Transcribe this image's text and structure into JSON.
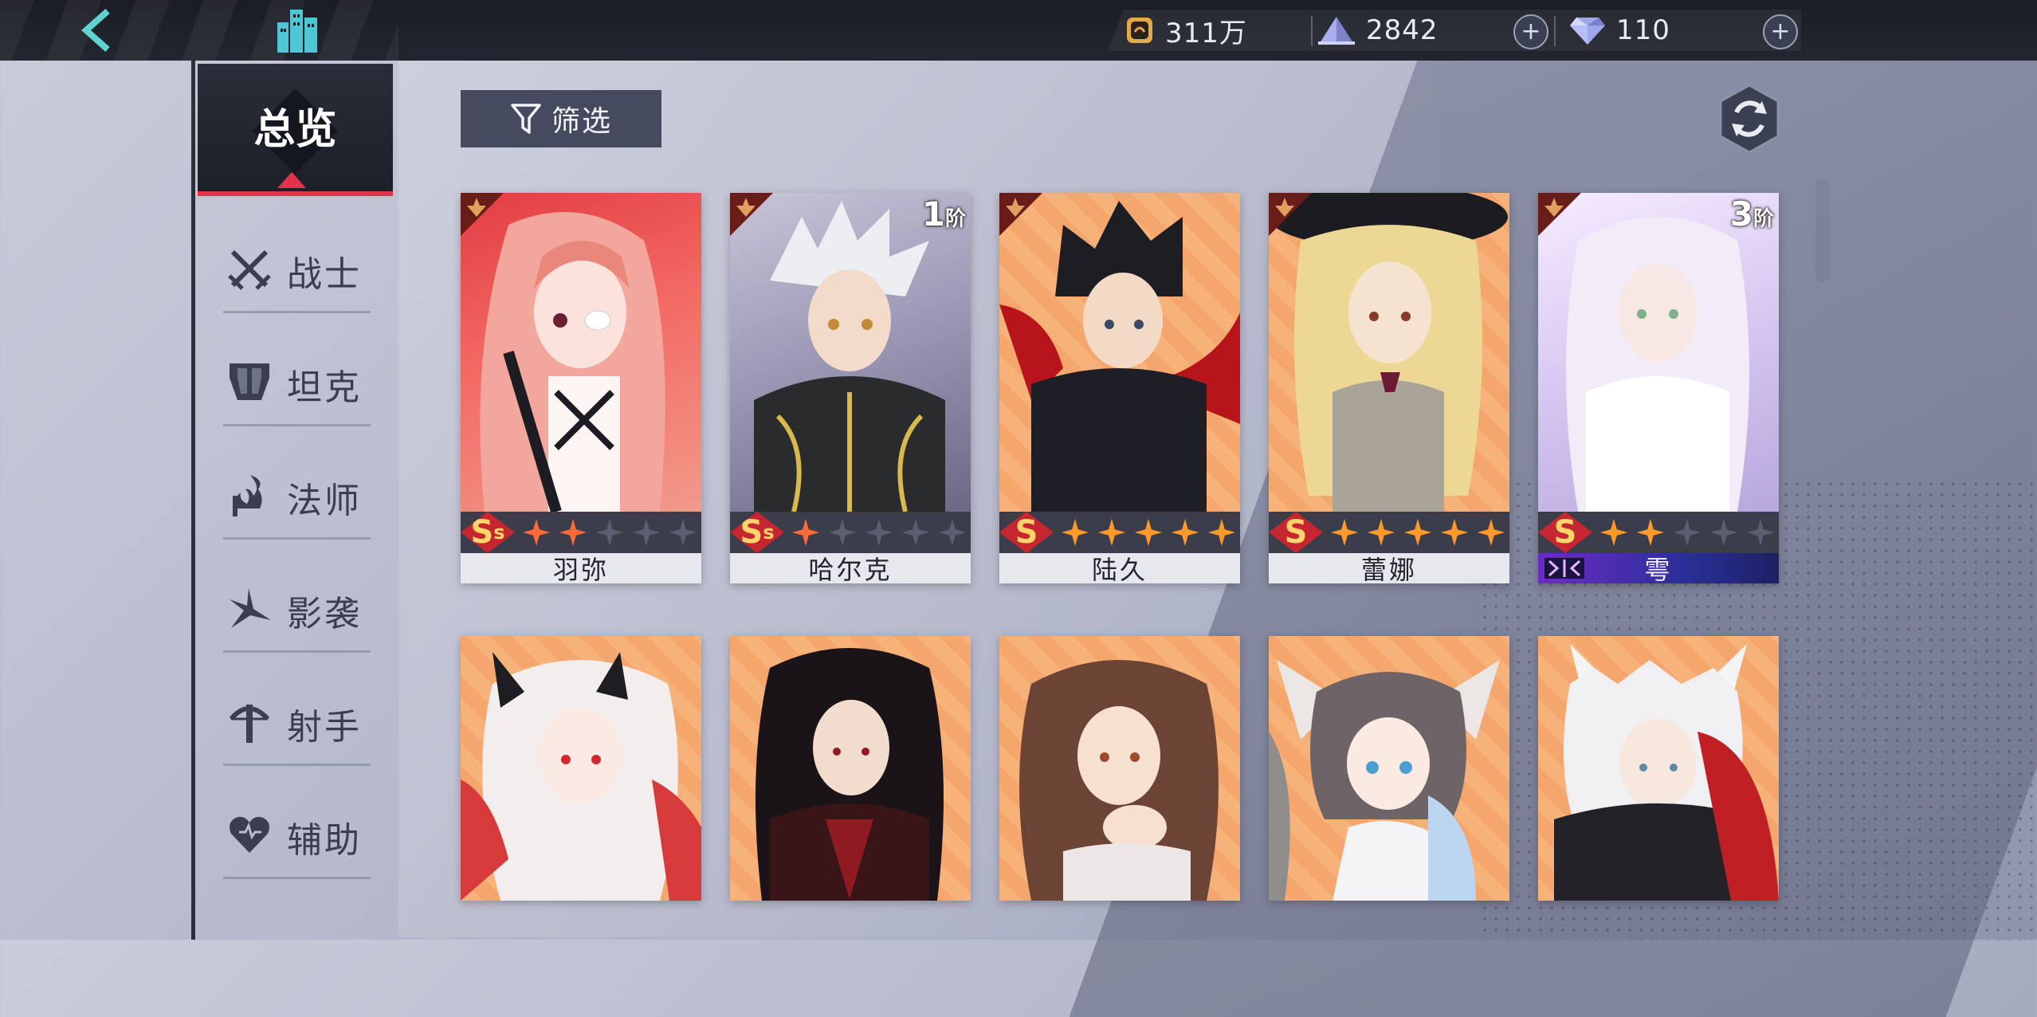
{
  "resources": {
    "gold": "311万",
    "crystal": "2842",
    "diamond": "110"
  },
  "sidebar": {
    "overview": "总览",
    "items": [
      {
        "label": "战士",
        "icon": "crossed-swords-icon"
      },
      {
        "label": "坦克",
        "icon": "tank-shield-icon"
      },
      {
        "label": "法师",
        "icon": "mage-staff-icon"
      },
      {
        "label": "影袭",
        "icon": "shadow-blade-icon"
      },
      {
        "label": "射手",
        "icon": "bow-icon"
      },
      {
        "label": "辅助",
        "icon": "heart-icon"
      }
    ]
  },
  "toolbar": {
    "filter_label": "筛选"
  },
  "heroes": [
    {
      "name": "羽弥",
      "grade": "S",
      "grade_sub": "s",
      "stars_lit": 2,
      "stars_total": 5,
      "rank": "",
      "accent": "#e23c43"
    },
    {
      "name": "哈尔克",
      "grade": "S",
      "grade_sub": "s",
      "stars_lit": 1,
      "stars_total": 5,
      "rank": "1",
      "rank_unit": "阶",
      "accent": "#8e8aa6"
    },
    {
      "name": "陆久",
      "grade": "S",
      "grade_sub": "",
      "stars_lit": 5,
      "stars_total": 5,
      "rank": "",
      "accent": "#f6aa70"
    },
    {
      "name": "蕾娜",
      "grade": "S",
      "grade_sub": "",
      "stars_lit": 5,
      "stars_total": 5,
      "rank": "",
      "accent": "#f6aa70"
    },
    {
      "name": "雩",
      "grade": "S",
      "grade_sub": "",
      "stars_lit": 2,
      "stars_total": 5,
      "rank": "3",
      "rank_unit": "阶",
      "accent": "#d6c8f1",
      "special": true
    },
    {
      "name": "",
      "accent": "#f6aa70"
    },
    {
      "name": "",
      "accent": "#f6aa70"
    },
    {
      "name": "",
      "accent": "#f6aa70"
    },
    {
      "name": "",
      "accent": "#f6aa70"
    },
    {
      "name": "",
      "accent": "#f6aa70"
    }
  ]
}
